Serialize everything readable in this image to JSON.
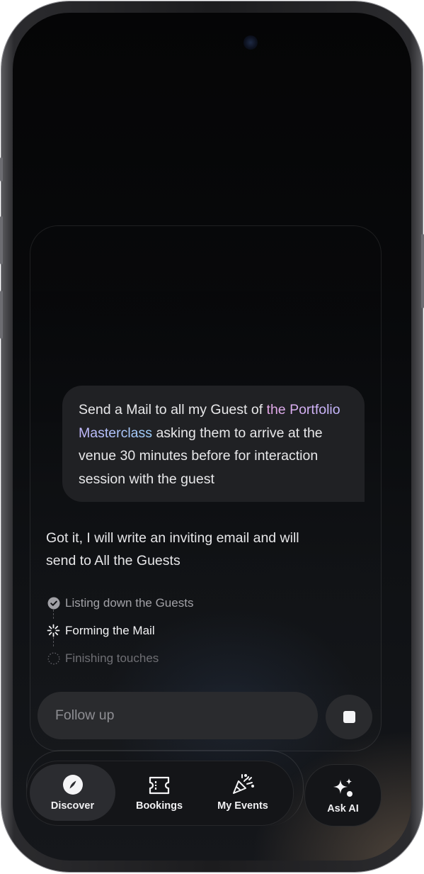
{
  "chat": {
    "user_message": {
      "before": "Send a Mail to all my Guest of ",
      "highlight": "the Portfolio Masterclass",
      "after": " asking them to arrive at the venue 30 minutes before for interaction session with the guest"
    },
    "ai_reply": "Got it, I will write an inviting email and will send to All the Guests",
    "steps": [
      {
        "label": "Listing down the Guests",
        "status": "done",
        "icon": "check-circle-icon"
      },
      {
        "label": "Forming the Mail",
        "status": "active",
        "icon": "loading-spinner-icon"
      },
      {
        "label": "Finishing touches",
        "status": "pending",
        "icon": "dotted-circle-icon"
      }
    ]
  },
  "input": {
    "placeholder": "Follow up",
    "stop_icon": "stop-square-icon"
  },
  "nav": {
    "items": [
      {
        "label": "Discover",
        "icon": "compass-icon",
        "active": true
      },
      {
        "label": "Bookings",
        "icon": "ticket-icon",
        "active": false
      },
      {
        "label": "My Events",
        "icon": "party-popper-icon",
        "active": false
      }
    ],
    "ask_ai": {
      "label": "Ask AI",
      "icon": "sparkles-icon"
    }
  },
  "colors": {
    "background": "#0a0b0d",
    "bubble": "#202124",
    "input": "#2a2b2e",
    "highlight_start": "#e6a9e8",
    "highlight_end": "#9fd2ff"
  }
}
